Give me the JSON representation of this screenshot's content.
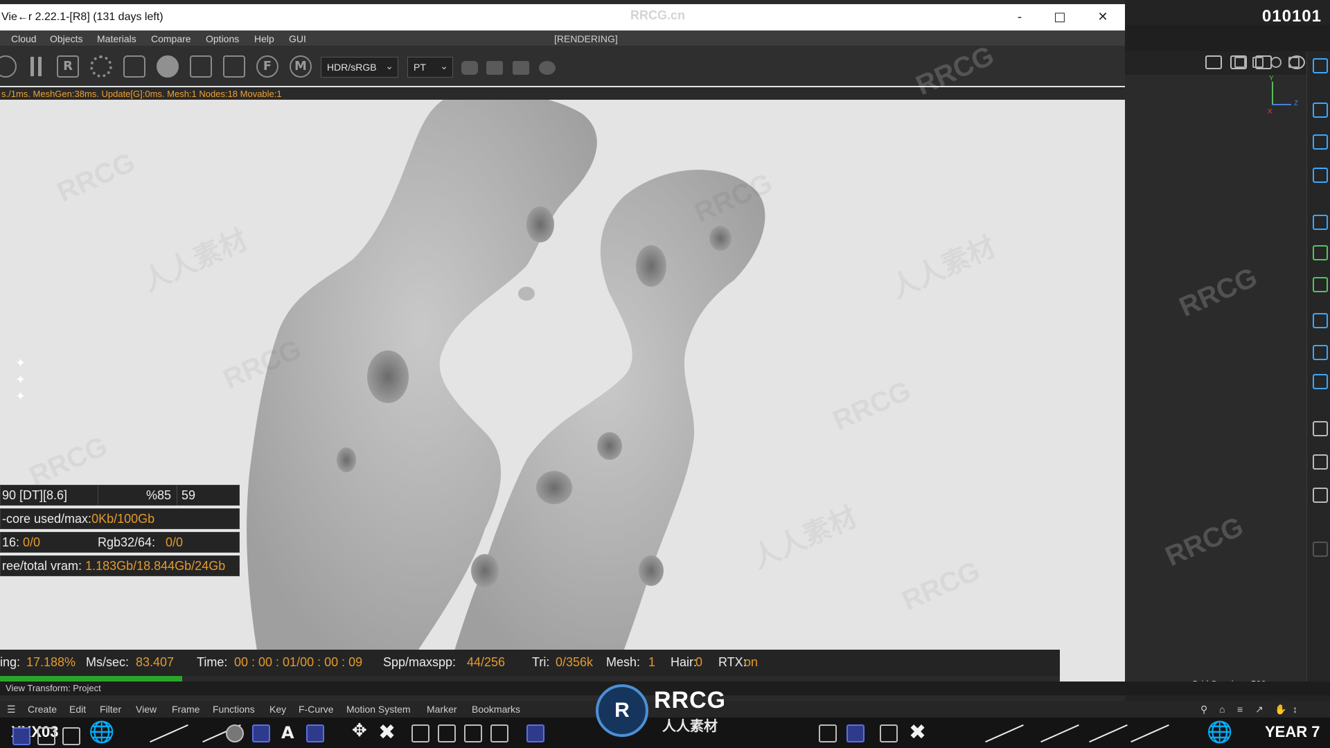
{
  "window": {
    "title": "Vie←r 2.22.1-[R8] (131 days left)",
    "watermark_title": "RRCG.cn",
    "minimize": "-",
    "maximize": "□",
    "close": "✕"
  },
  "menu": {
    "items": [
      "Cloud",
      "Objects",
      "Materials",
      "Compare",
      "Options",
      "Help",
      "GUI"
    ],
    "render_state": "[RENDERING]"
  },
  "toolbar": {
    "icons": [
      "refresh-icon",
      "pause-icon",
      "r-icon",
      "gear-icon",
      "lock-icon",
      "sphere-icon",
      "add-region-icon",
      "focus-icon",
      "f-icon",
      "m-icon"
    ],
    "r_label": "R",
    "f_label": "F",
    "m_label": "M",
    "color_space": "HDR/sRGB",
    "kernel": "PT"
  },
  "log": {
    "text": "s./1ms. MeshGen:38ms. Update[G]:0ms. Mesh:1 Nodes:18 Movable:1"
  },
  "stats": {
    "row1": {
      "a": "90 [DT][8.6]",
      "b": "%85",
      "c": "59"
    },
    "row2": {
      "label": "-core used/max:",
      "value": "0Kb/100Gb"
    },
    "row3": {
      "label": "16:",
      "value": "0/0",
      "label2": "Rgb32/64:",
      "value2": "0/0"
    },
    "row4": {
      "label": "ree/total vram:",
      "value": "1.183Gb/18.844Gb/24Gb"
    }
  },
  "status": {
    "rendering_label": "ing:",
    "rendering_value": "17.188%",
    "ms_label": "Ms/sec:",
    "ms_value": "83.407",
    "time_label": "Time:",
    "time_value": "00 : 00 : 01/00 : 00 : 09",
    "spp_label": "Spp/maxspp:",
    "spp_value": "44/256",
    "tri_label": "Tri:",
    "tri_value": "0/356k",
    "mesh_label": "Mesh:",
    "mesh_value": "1",
    "hair_label": "Hair:",
    "hair_value": "0",
    "rtx_label": "RTX:",
    "rtx_value": "on",
    "progress": 0.17188
  },
  "c4d": {
    "frame_code": "010101",
    "grid_spacing": "Grid Spacing : 500 cm",
    "view_transform": "View Transform: Project",
    "axis_y": "Y",
    "axis_z": "Z",
    "axis_x": "X",
    "timeline_menu": [
      "Create",
      "Edit",
      "Filter",
      "View",
      "Frame",
      "Functions",
      "Key",
      "F-Curve",
      "Motion System",
      "Marker",
      "Bookmarks"
    ],
    "bottom_left_text": "XXX03",
    "bottom_right_text": "YEAR 7"
  },
  "logo": {
    "mark": "R",
    "name": "RRCG",
    "sub": "人人素材"
  },
  "viewport_watermark": "RRCG",
  "viewport_watermark_cn": "人人素材",
  "colors": {
    "accent_orange": "#e39a2e",
    "progress_green": "#2aa52a",
    "icon_blue": "#3ba8ff",
    "viewport_bg": "#e4e4e4"
  }
}
